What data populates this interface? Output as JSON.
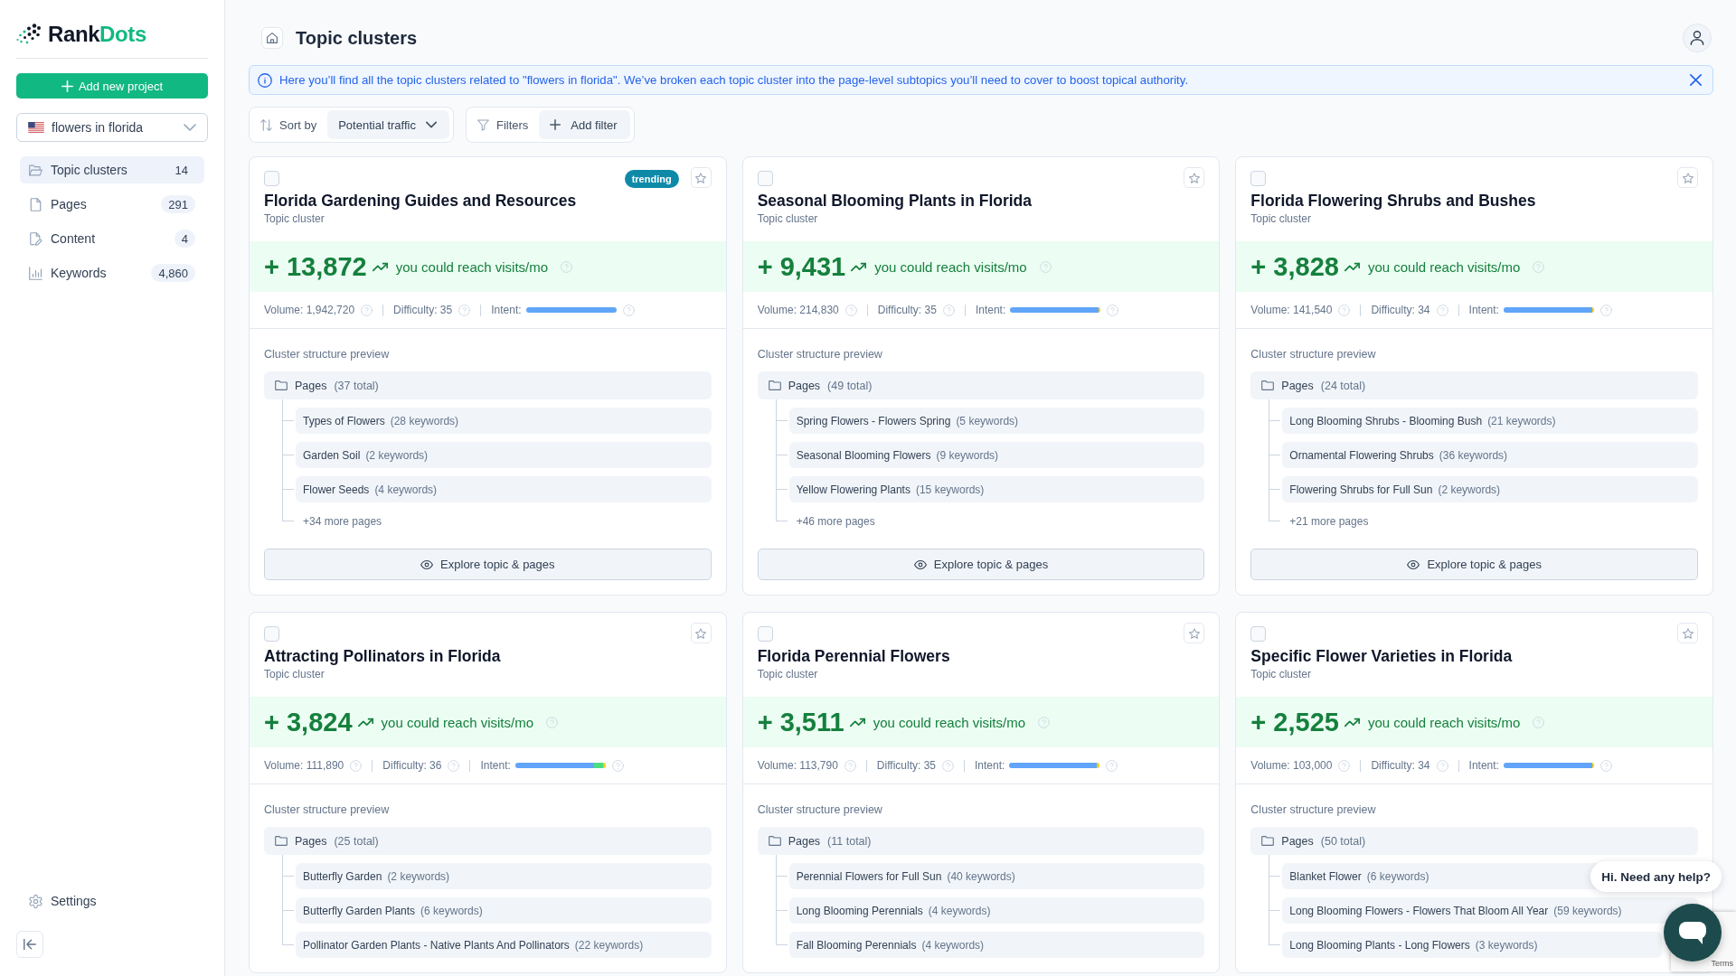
{
  "sidebar": {
    "logo": {
      "text": "Rank",
      "accent": "Dots"
    },
    "add_button": "Add new project",
    "project": "flowers in florida",
    "nav": [
      {
        "label": "Topic clusters",
        "count": "14",
        "selected": true
      },
      {
        "label": "Pages",
        "count": "291",
        "selected": false
      },
      {
        "label": "Content",
        "count": "4",
        "selected": false
      },
      {
        "label": "Keywords",
        "count": "4,860",
        "selected": false
      }
    ],
    "settings": "Settings"
  },
  "header": {
    "title": "Topic clusters"
  },
  "notice": {
    "text": "Here you’ll find all the topic clusters related to \"flowers in florida\". We’ve broken each topic cluster into the page-level subtopics you’ll need to cover to boost topical authority."
  },
  "toolbar": {
    "sort_label": "Sort by",
    "sort_value": "Potential traffic",
    "filters_label": "Filters",
    "add_filter": "Add filter"
  },
  "cards": [
    {
      "checked": false,
      "starred": false,
      "badge": "trending",
      "title": "Florida Gardening Guides and Resources",
      "subtitle": "Topic cluster",
      "traffic": "+ 13,872",
      "traffic_label": "you could reach visits/mo",
      "volume": "Volume: 1,942,720",
      "difficulty": "Difficulty: 35",
      "intent_label": "Intent:",
      "intent": [
        {
          "level": 1,
          "color": "#60a5fa"
        }
      ],
      "preview_label": "Cluster structure preview",
      "pages": {
        "label": "Pages",
        "total": "(37 total)",
        "children": [
          {
            "title": "Types of Flowers",
            "keywords": "(28 keywords)"
          },
          {
            "title": "Garden Soil",
            "keywords": "(2 keywords)"
          },
          {
            "title": "Flower Seeds",
            "keywords": "(4 keywords)"
          }
        ]
      },
      "more": "+34 more pages",
      "explore": "Explore topic & pages"
    },
    {
      "checked": false,
      "starred": false,
      "title": "Seasonal Blooming Plants in Florida",
      "subtitle": "Topic cluster",
      "traffic": "+ 9,431",
      "traffic_label": "you could reach visits/mo",
      "volume": "Volume: 214,830",
      "difficulty": "Difficulty: 35",
      "intent_label": "Intent:",
      "intent": [
        {
          "level": 0.98,
          "color": "#60a5fa"
        },
        {
          "level": 0.02,
          "color": "#facc15"
        }
      ],
      "preview_label": "Cluster structure preview",
      "pages": {
        "label": "Pages",
        "total": "(49 total)",
        "children": [
          {
            "title": "Spring Flowers - Flowers Spring",
            "keywords": "(5 keywords)"
          },
          {
            "title": "Seasonal Blooming Flowers",
            "keywords": "(9 keywords)"
          },
          {
            "title": "Yellow Flowering Plants",
            "keywords": "(15 keywords)"
          }
        ]
      },
      "more": "+46 more pages",
      "explore": "Explore topic & pages"
    },
    {
      "checked": false,
      "starred": false,
      "title": "Florida Flowering Shrubs and Bushes",
      "subtitle": "Topic cluster",
      "traffic": "+ 3,828",
      "traffic_label": "you could reach visits/mo",
      "volume": "Volume: 141,540",
      "difficulty": "Difficulty: 34",
      "intent_label": "Intent:",
      "intent": [
        {
          "level": 0.98,
          "color": "#60a5fa"
        },
        {
          "level": 0.02,
          "color": "#facc15"
        }
      ],
      "preview_label": "Cluster structure preview",
      "pages": {
        "label": "Pages",
        "total": "(24 total)",
        "children": [
          {
            "title": "Long Blooming Shrubs - Blooming Bush",
            "keywords": "(21 keywords)"
          },
          {
            "title": "Ornamental Flowering Shrubs",
            "keywords": "(36 keywords)"
          },
          {
            "title": "Flowering Shrubs for Full Sun",
            "keywords": "(2 keywords)"
          }
        ]
      },
      "more": "+21 more pages",
      "explore": "Explore topic & pages"
    },
    {
      "checked": false,
      "starred": false,
      "title": "Attracting Pollinators in Florida",
      "subtitle": "Topic cluster",
      "traffic": "+ 3,824",
      "traffic_label": "you could reach visits/mo",
      "volume": "Volume: 111,890",
      "difficulty": "Difficulty: 36",
      "intent_label": "Intent:",
      "intent": [
        {
          "level": 0.87,
          "color": "#60a5fa"
        },
        {
          "level": 0.1,
          "color": "#4ade80"
        },
        {
          "level": 0.03,
          "color": "#facc15"
        }
      ],
      "preview_label": "Cluster structure preview",
      "pages": {
        "label": "Pages",
        "total": "(25 total)",
        "children": [
          {
            "title": "Butterfly Garden",
            "keywords": "(2 keywords)"
          },
          {
            "title": "Butterfly Garden Plants",
            "keywords": "(6 keywords)"
          },
          {
            "title": "Pollinator Garden Plants - Native Plants And Pollinators",
            "keywords": "(22 keywords)"
          }
        ]
      }
    },
    {
      "checked": false,
      "starred": false,
      "title": "Florida Perennial Flowers",
      "subtitle": "Topic cluster",
      "traffic": "+ 3,511",
      "traffic_label": "you could reach visits/mo",
      "volume": "Volume: 113,790",
      "difficulty": "Difficulty: 35",
      "intent_label": "Intent:",
      "intent": [
        {
          "level": 0.97,
          "color": "#60a5fa"
        },
        {
          "level": 0.03,
          "color": "#facc15"
        }
      ],
      "preview_label": "Cluster structure preview",
      "pages": {
        "label": "Pages",
        "total": "(11 total)",
        "children": [
          {
            "title": "Perennial Flowers for Full Sun",
            "keywords": "(40 keywords)"
          },
          {
            "title": "Long Blooming Perennials",
            "keywords": "(4 keywords)"
          },
          {
            "title": "Fall Blooming Perennials",
            "keywords": "(4 keywords)"
          }
        ]
      }
    },
    {
      "checked": false,
      "starred": false,
      "title": "Specific Flower Varieties in Florida",
      "subtitle": "Topic cluster",
      "traffic": "+ 2,525",
      "traffic_label": "you could reach visits/mo",
      "volume": "Volume: 103,000",
      "difficulty": "Difficulty: 34",
      "intent_label": "Intent:",
      "intent": [
        {
          "level": 0.98,
          "color": "#60a5fa"
        },
        {
          "level": 0.02,
          "color": "#facc15"
        }
      ],
      "preview_label": "Cluster structure preview",
      "pages": {
        "label": "Pages",
        "total": "(50 total)",
        "children": [
          {
            "title": "Blanket Flower",
            "keywords": "(6 keywords)"
          },
          {
            "title": "Long Blooming Flowers - Flowers That Bloom All Year",
            "keywords": "(59 keywords)"
          },
          {
            "title": "Long Blooming Plants - Long Flowers",
            "keywords": "(3 keywords)"
          }
        ]
      }
    }
  ],
  "chat": {
    "message": "Hi. Need any help?"
  },
  "recaptcha": {
    "link": "Terms"
  }
}
